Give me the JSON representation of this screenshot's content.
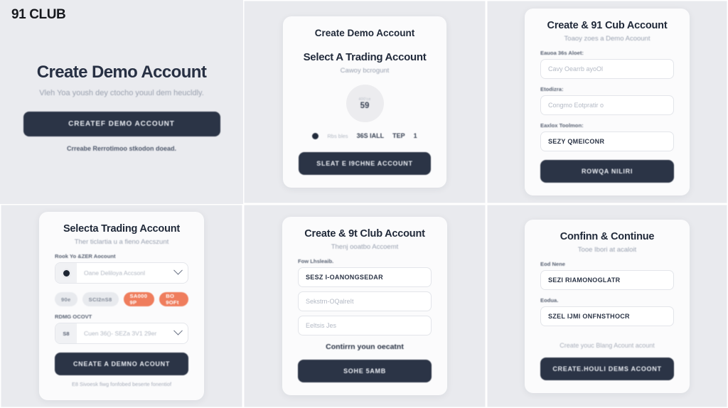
{
  "meta": {
    "layout": "2x3 collage of UI mockup screenshots",
    "background": "#e9eaee",
    "gutter_color": "#ffffff",
    "accent_dark": "#2b3446",
    "accent_orange": "#ef7d5d",
    "card_bg": "#fbfbfc"
  },
  "panel1": {
    "brand": "91 CLUB",
    "title": "Create Demo Account",
    "subtitle": "Vleh Yoa yoush dey ctocho youul dem heucldly.",
    "button": "CREATEF DEMO ACCOUNT",
    "note": "Crreabe Rerrotimoo stkodon doead."
  },
  "panel2": {
    "header": "Create Demo Account",
    "section_title": "Select A Trading Account",
    "section_subtitle": "Cawoy bcrogunt",
    "badge": {
      "caption": "400'ce",
      "value": "59"
    },
    "meta": [
      {
        "label": "Rbs bles",
        "style": "dim"
      },
      {
        "label": "36S IALL",
        "style": "bold"
      },
      {
        "label": "TEP",
        "style": "bold"
      },
      {
        "label": "1",
        "style": "bold"
      }
    ],
    "button": "SLEAT E I9CHNE ACCOUNT"
  },
  "panel3": {
    "title": "Create & 91 Cub Account",
    "subtitle": "Toaoy zoes a Demo Acoount",
    "fields": [
      {
        "label": "Eauoa 36s Aloet:",
        "value": "Cavy Oearrb ayoOl",
        "filled": false
      },
      {
        "label": "Etodizra:",
        "value": "Congmo Eotpratir o",
        "filled": false
      },
      {
        "label": "Eaxlox Toolmon:",
        "value": "SEZY QMEICONR",
        "filled": true
      }
    ],
    "button": "ROWQA NILIRI"
  },
  "panel4": {
    "title": "Selecta Trading Account",
    "subtitle": "Ther ticlartia u a fieno Aecszunt",
    "group1_label": "Rook Yo &ZER Aocount",
    "dropdown1": {
      "placeholder": "Oane Deliloya Accsonl",
      "icon": "radio-icon"
    },
    "chips": [
      {
        "label": "90e",
        "color": "gray"
      },
      {
        "label": "SCI2nS8",
        "color": "gray"
      },
      {
        "label": "SA000 9P",
        "color": "orange"
      },
      {
        "label": "BO 9OFt",
        "color": "orange"
      }
    ],
    "group2_label": "RDMG OCOVT",
    "dropdown2": {
      "prefix": "S8",
      "placeholder": "Cuen 36()- SEZa 3V1 29er",
      "icon": "chevron-down-icon"
    },
    "button": "CNEATE A DEMNO ACOUNT",
    "footer": "E8 Sivoesk fiwg fonfobed beserte fonentiof"
  },
  "panel5": {
    "title": "Create & 9t Club Account",
    "subtitle": "Thenj ooatbo Accoemt",
    "first_label": "Fow Lhsleaib.",
    "fields": [
      {
        "value": "SESZ I-OANONGSEDAR",
        "filled": true
      },
      {
        "value": "Sekstrn-OQalreIt",
        "filled": false
      },
      {
        "value": "Eeltsis Jes",
        "filled": false
      }
    ],
    "confirm_note": "Contirrn youn oecatnt",
    "button": "SOHE 5AMB"
  },
  "panel6": {
    "title": "Confinn & Continue",
    "subtitle": "Tooe Ibori at acaloit",
    "fields": [
      {
        "label": "Eod Nene",
        "value": "SEZI RIAMONOGLATR",
        "filled": true
      },
      {
        "label": "Eodua.",
        "value": "SZEL IJMI ONFNSTHOCR",
        "filled": true
      }
    ],
    "ghost_note": "Create youc Blang Acount acount",
    "button": "CREATE.HOULI DEMS ACOONT"
  }
}
